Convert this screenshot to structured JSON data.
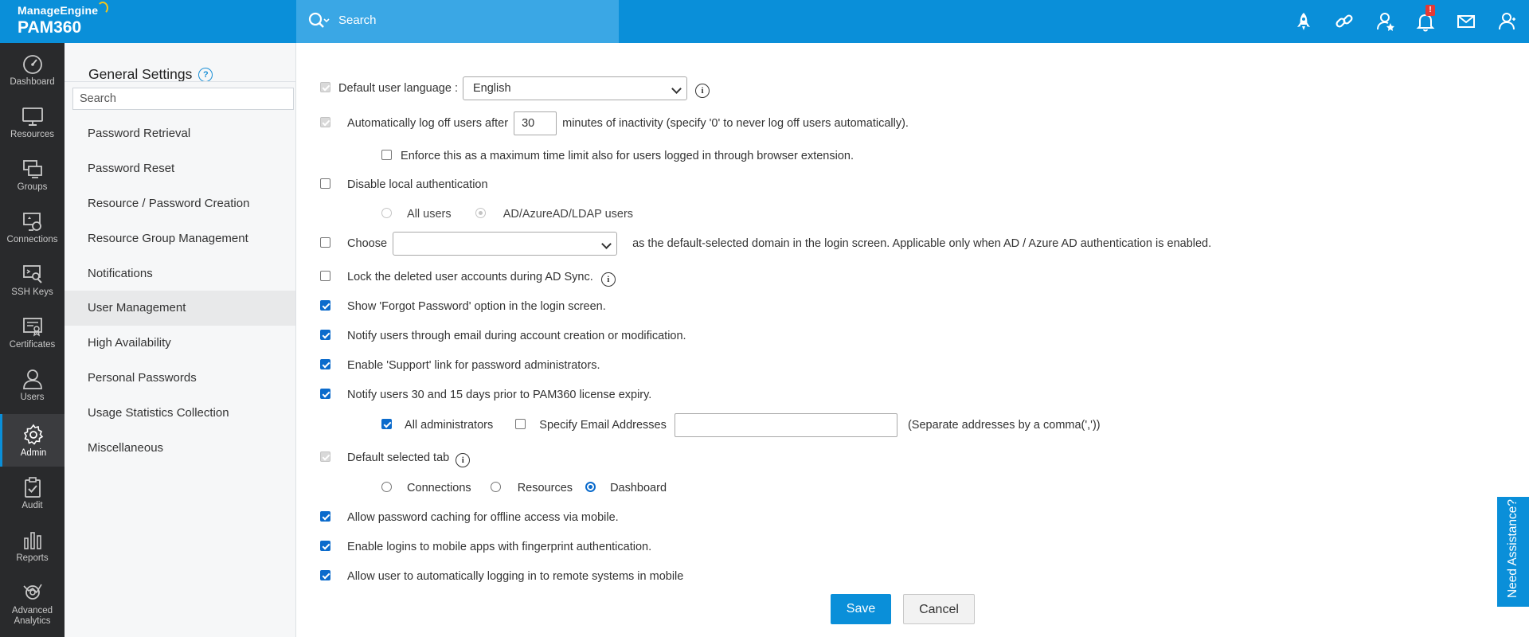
{
  "app": {
    "brand": "ManageEngine",
    "product": "PAM360"
  },
  "search": {
    "placeholder": "Search"
  },
  "top_icons": [
    "rocket-icon",
    "link-icon",
    "user-star-icon",
    "bell-icon",
    "mail-icon",
    "user-profile-icon"
  ],
  "notification_badge": "!",
  "rail": [
    {
      "label": "Dashboard",
      "icon": "gauge-icon"
    },
    {
      "label": "Resources",
      "icon": "monitor-icon"
    },
    {
      "label": "Groups",
      "icon": "groups-icon"
    },
    {
      "label": "Connections",
      "icon": "connections-icon"
    },
    {
      "label": "SSH Keys",
      "icon": "ssh-key-icon"
    },
    {
      "label": "Certificates",
      "icon": "certificate-icon"
    },
    {
      "label": "Users",
      "icon": "user-icon"
    },
    {
      "label": "Admin",
      "icon": "gear-icon",
      "active": true
    },
    {
      "label": "Audit",
      "icon": "clipboard-check-icon"
    },
    {
      "label": "Reports",
      "icon": "bar-chart-icon"
    },
    {
      "label": "Advanced Analytics",
      "icon": "analytics-icon"
    }
  ],
  "settings_nav": {
    "title": "General Settings",
    "help": "?",
    "search_placeholder": "Search",
    "items": [
      "Password Retrieval",
      "Password Reset",
      "Resource / Password Creation",
      "Resource Group Management",
      "Notifications",
      "User Management",
      "High Availability",
      "Personal Passwords",
      "Usage Statistics Collection",
      "Miscellaneous"
    ],
    "active_item": "User Management"
  },
  "form": {
    "default_language": {
      "label": "Default user language :",
      "value": "English",
      "checked": true,
      "disabled": true
    },
    "auto_logoff": {
      "label_before": "Automatically log off users after",
      "minutes": "30",
      "label_after": "minutes of inactivity (specify '0' to never log off users automatically).",
      "checked": true,
      "disabled": true
    },
    "enforce_max": {
      "label": "Enforce this as a maximum time limit also for users logged in through browser extension.",
      "checked": false
    },
    "disable_local_auth": {
      "label": "Disable local authentication",
      "checked": false
    },
    "auth_scope": {
      "options": [
        "All users",
        "AD/AzureAD/LDAP users"
      ],
      "selected": "AD/AzureAD/LDAP users",
      "disabled": true
    },
    "choose_domain": {
      "label_before": "Choose",
      "value": "",
      "label_after": "as the default-selected domain in the login screen. Applicable only when AD / Azure AD authentication is enabled.",
      "checked": false
    },
    "lock_deleted": {
      "label": "Lock the deleted user accounts during AD Sync.",
      "checked": false
    },
    "forgot_password": {
      "label": "Show 'Forgot Password' option in the login screen.",
      "checked": true
    },
    "notify_email": {
      "label": "Notify users through email during account creation or modification.",
      "checked": true
    },
    "support_link": {
      "label": "Enable 'Support' link for password administrators.",
      "checked": true
    },
    "license_expiry": {
      "label": "Notify users 30 and 15 days prior to PAM360 license expiry.",
      "checked": true
    },
    "recipients": {
      "all_admins": {
        "label": "All administrators",
        "checked": true
      },
      "specify_email": {
        "label": "Specify Email Addresses",
        "checked": false
      },
      "email_value": "",
      "hint": "(Separate addresses by a comma(','))"
    },
    "default_tab": {
      "label": "Default selected tab",
      "checked": true,
      "disabled": true,
      "options": [
        "Connections",
        "Resources",
        "Dashboard"
      ],
      "selected": "Dashboard"
    },
    "password_caching": {
      "label": "Allow password caching for offline access via mobile.",
      "checked": true
    },
    "fingerprint": {
      "label": "Enable logins to mobile apps with fingerprint authentication.",
      "checked": true
    },
    "auto_login_remote": {
      "label": "Allow user to automatically logging in to remote systems in mobile",
      "checked": true
    }
  },
  "buttons": {
    "save": "Save",
    "cancel": "Cancel"
  },
  "assistance": "Need Assistance?",
  "colors": {
    "primary": "#0a8fd9",
    "rail_bg": "#292a2c",
    "checkbox_blue": "#0b6bcc"
  }
}
